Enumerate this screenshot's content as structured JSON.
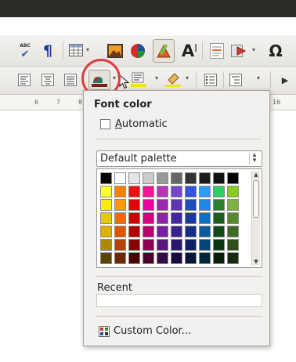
{
  "toolbar": {
    "spellcheck_label": "ABC",
    "pilcrow": "¶",
    "fontwork_label": "A",
    "omega": "Ω",
    "font_color_dropdown": "▾"
  },
  "ruler": {
    "ticks": [
      "6",
      "7",
      "8",
      "16"
    ]
  },
  "font_color_popup": {
    "title": "Font color",
    "automatic_label": "Automatic",
    "palette_selected": "Default palette",
    "recent_label": "Recent",
    "custom_color_label": "Custom Color...",
    "colors": [
      "#000000",
      "#ffffff",
      "#e6e6e6",
      "#cccccc",
      "#999999",
      "#666666",
      "#333333",
      "#1c1c1c",
      "#111111",
      "#000000",
      "#ffff33",
      "#ff8000",
      "#ee1111",
      "#ff1493",
      "#bb33bb",
      "#7744cc",
      "#3355dd",
      "#2a9df4",
      "#33cc66",
      "#88cc22",
      "#ffee00",
      "#ff9900",
      "#e60000",
      "#f000a0",
      "#9c27b0",
      "#5e35b1",
      "#1a4dbf",
      "#1e88e5",
      "#2e7d32",
      "#7cb342",
      "#e6c800",
      "#ff6600",
      "#cc0000",
      "#d5007f",
      "#8e24aa",
      "#4527a0",
      "#1a3aa0",
      "#0d6fc0",
      "#1b5e20",
      "#558b2f",
      "#e0b000",
      "#e05500",
      "#b00000",
      "#b8006e",
      "#7b1fa2",
      "#3a1f8f",
      "#152e88",
      "#0a5aa0",
      "#134a18",
      "#3f6b22",
      "#b08800",
      "#b84300",
      "#8a0000",
      "#8f0055",
      "#5c1580",
      "#2a166e",
      "#0f2268",
      "#074478",
      "#0d3510",
      "#2e4f18",
      "#5a4500",
      "#6e2800",
      "#4a0000",
      "#4d002e",
      "#330b47",
      "#170c3d",
      "#08133a",
      "#04263f",
      "#061d08",
      "#19290c"
    ]
  }
}
